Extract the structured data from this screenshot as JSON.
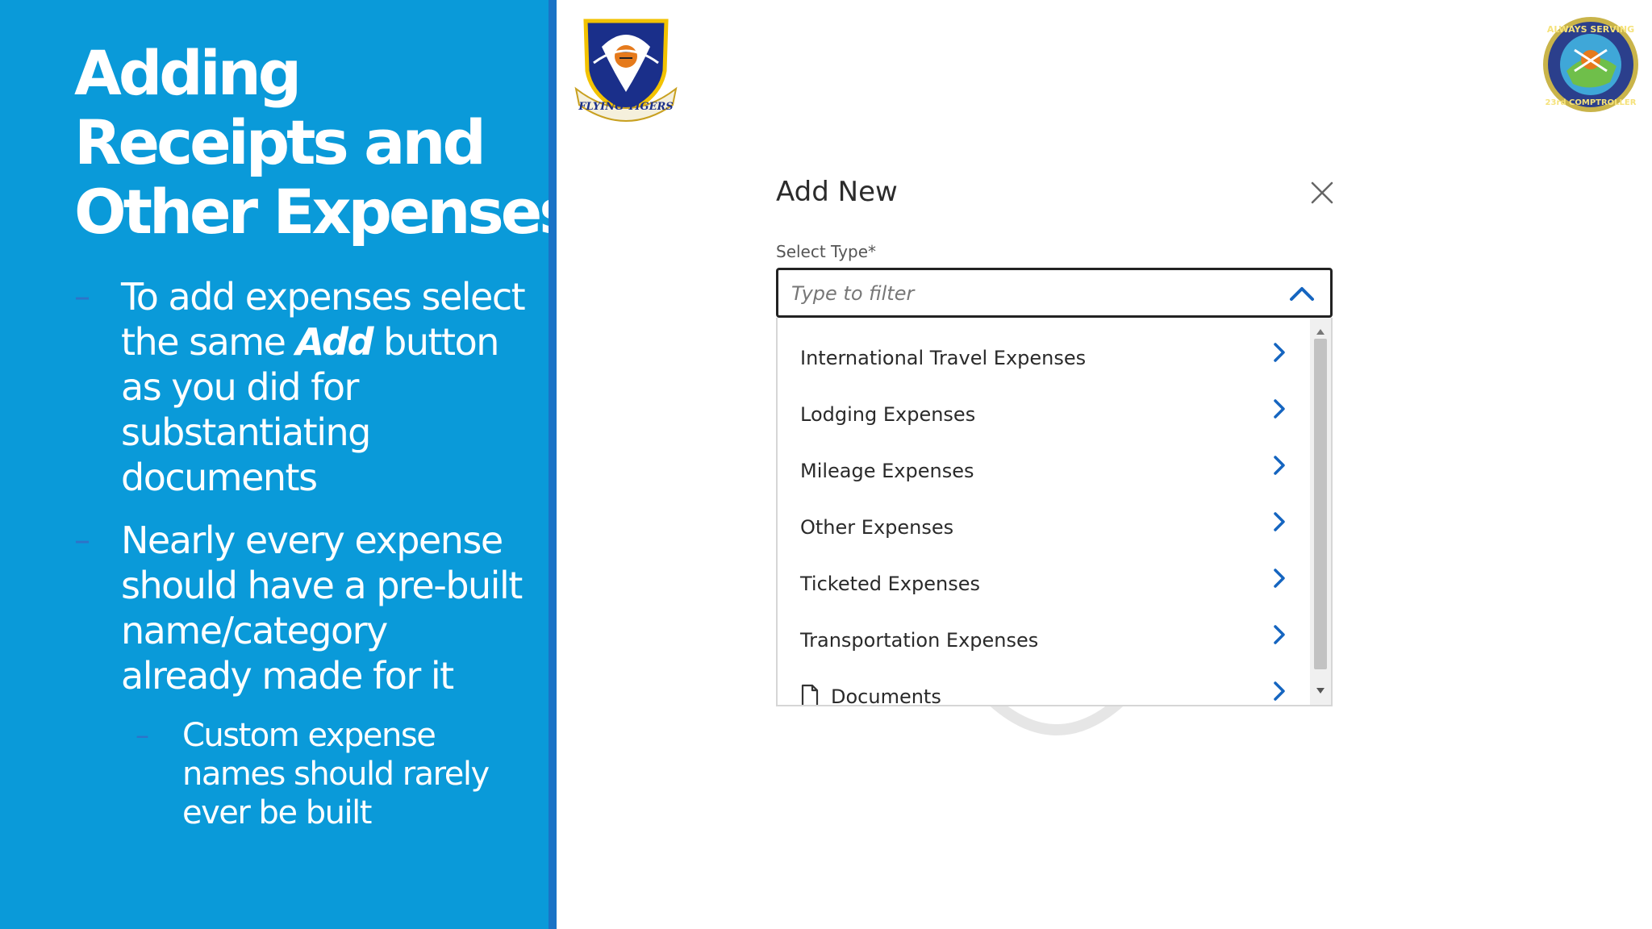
{
  "slide": {
    "title_lines": [
      "Adding",
      "Receipts and",
      "Other Expenses"
    ],
    "bullets": [
      {
        "text_before": "To add expenses select the same ",
        "emphasis": "Add",
        "text_after": " button as you did for substantiating documents"
      },
      {
        "text": "Nearly every expense should have a pre-built name/category already made for it"
      }
    ],
    "sub_bullets": [
      {
        "text": "Custom expense names should rarely ever be built"
      }
    ],
    "bullet_marker": "–"
  },
  "logos": {
    "left": {
      "text": "FLYING TIGERS",
      "icon": "flying-tigers-shield-icon"
    },
    "right": {
      "text_top": "ALWAYS SERVING",
      "text_bottom": "23rd COMPTROLLER",
      "icon": "comptroller-patch-icon"
    }
  },
  "dialog": {
    "title": "Add New",
    "close_icon": "close-icon",
    "field_label": "Select Type*",
    "filter_placeholder": "Type to filter",
    "items": [
      {
        "label": "International Travel Expenses",
        "icon": "chevron-right-icon"
      },
      {
        "label": "Lodging Expenses",
        "icon": "chevron-right-icon"
      },
      {
        "label": "Mileage Expenses",
        "icon": "chevron-right-icon"
      },
      {
        "label": "Other Expenses",
        "icon": "chevron-right-icon"
      },
      {
        "label": "Ticketed Expenses",
        "icon": "chevron-right-icon"
      },
      {
        "label": "Transportation Expenses",
        "icon": "chevron-right-icon"
      },
      {
        "label": "Documents",
        "icon": "chevron-right-icon",
        "leading_icon": "document-icon"
      }
    ]
  },
  "colors": {
    "panel_blue": "#0a9ad9",
    "panel_edge": "#1a73c6",
    "accent_blue": "#1565c0",
    "text_dark": "#2a2a2a"
  }
}
